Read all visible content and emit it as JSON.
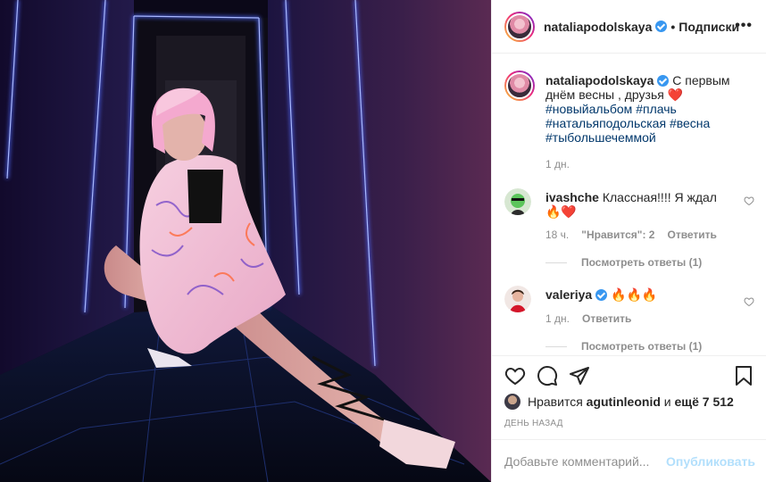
{
  "post": {
    "author": "nataliapodolskaya",
    "separator": "•",
    "follow_label": "Подписки",
    "more_label": "•••",
    "caption_text": "С первым днём весны , друзья ❤️",
    "hashtags": [
      "#новыйальбом",
      "#плачь",
      "#натальяподольская",
      "#весна",
      "#тыбольшечеммой"
    ],
    "caption_age": "1 дн."
  },
  "comments": [
    {
      "author": "ivashche",
      "text": "Классная!!!! Я ждал 🔥❤️",
      "age": "18 ч.",
      "likes": "\"Нравится\": 2",
      "reply": "Ответить",
      "view_replies": "Посмотреть ответы (1)"
    },
    {
      "author": "valeriya",
      "text": "🔥🔥🔥",
      "age": "1 дн.",
      "reply": "Ответить",
      "view_replies": "Посмотреть ответы (1)"
    }
  ],
  "likes": {
    "prefix": "Нравится",
    "user": "agutinleonid",
    "middle": "и",
    "others": "ещё 7 512"
  },
  "date_label": "ДЕНЬ НАЗАД",
  "add_comment": {
    "placeholder": "Добавьте комментарий...",
    "publish_label": "Опубликовать"
  },
  "icons": [
    "heart-icon",
    "comment-icon",
    "share-icon",
    "bookmark-icon",
    "more-icon",
    "verified-icon"
  ],
  "colors": {
    "link": "#00376b",
    "verified": "#3897f0",
    "muted": "#8e8e8e",
    "publish": "#b2dffc"
  }
}
